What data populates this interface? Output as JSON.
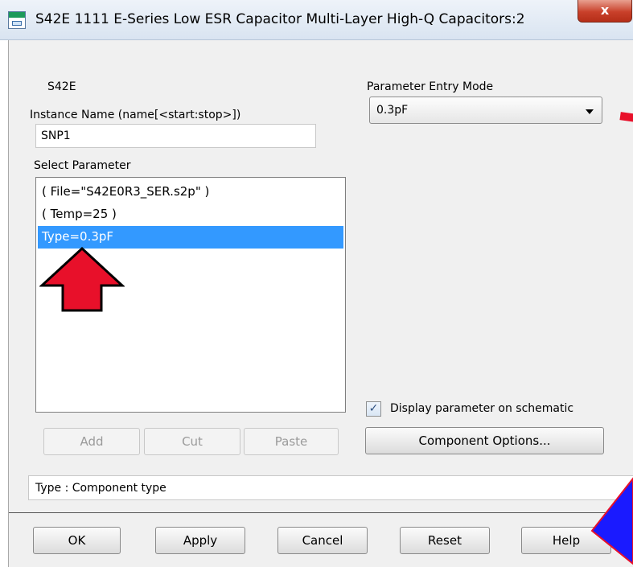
{
  "window": {
    "title": "S42E 1111 E-Series Low ESR Capacitor Multi-Layer High-Q Capacitors:2",
    "close_label": "x"
  },
  "component": {
    "name": "S42E",
    "instance_label": "Instance Name  (name[<start:stop>])",
    "instance_value": "SNP1"
  },
  "parameter_entry": {
    "label": "Parameter Entry Mode",
    "selected": "0.3pF"
  },
  "select_parameter": {
    "label": "Select Parameter",
    "items": [
      {
        "label": "( File=\"S42E0R3_SER.s2p\" )",
        "selected": false
      },
      {
        "label": "( Temp=25 )",
        "selected": false
      },
      {
        "label": "Type=0.3pF",
        "selected": true
      }
    ]
  },
  "list_buttons": {
    "add": "Add",
    "cut": "Cut",
    "paste": "Paste"
  },
  "display_checkbox": {
    "label": "Display parameter on schematic",
    "checked": true,
    "mark": "✓"
  },
  "component_options_label": "Component Options...",
  "status_text": "Type : Component type",
  "footer_buttons": {
    "ok": "OK",
    "apply": "Apply",
    "cancel": "Cancel",
    "reset": "Reset",
    "help": "Help"
  },
  "colors": {
    "selection": "#3399ff",
    "annotation_arrow": "#e8102a",
    "annotation_diamond": "#1a1aff"
  }
}
